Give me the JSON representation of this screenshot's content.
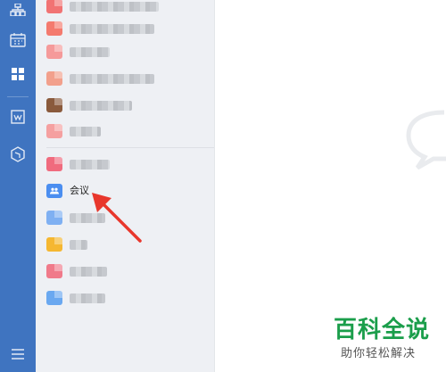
{
  "rail": {
    "icons": [
      "org-chart-icon",
      "calendar-icon",
      "apps-grid-icon",
      "docs-icon",
      "box-icon",
      "menu-icon"
    ],
    "active": "apps-grid-icon",
    "color": "#3f74c0"
  },
  "list": {
    "meeting_item": {
      "label": "会议",
      "icon": "meeting-icon",
      "color": "#4b8ef0"
    },
    "obscured_item_colors": [
      "#f17373",
      "#f47a6e",
      "#f59a9a",
      "#f2a08c",
      "#8a5a3c",
      "#f5a0a0",
      "#f06b7e",
      "#7fb0f2",
      "#f5b731",
      "#f07a8a",
      "#6aa8f0"
    ]
  },
  "watermark": {
    "title": "百科全说",
    "subtitle": "助你轻松解决",
    "color": "#1b9e4b"
  }
}
